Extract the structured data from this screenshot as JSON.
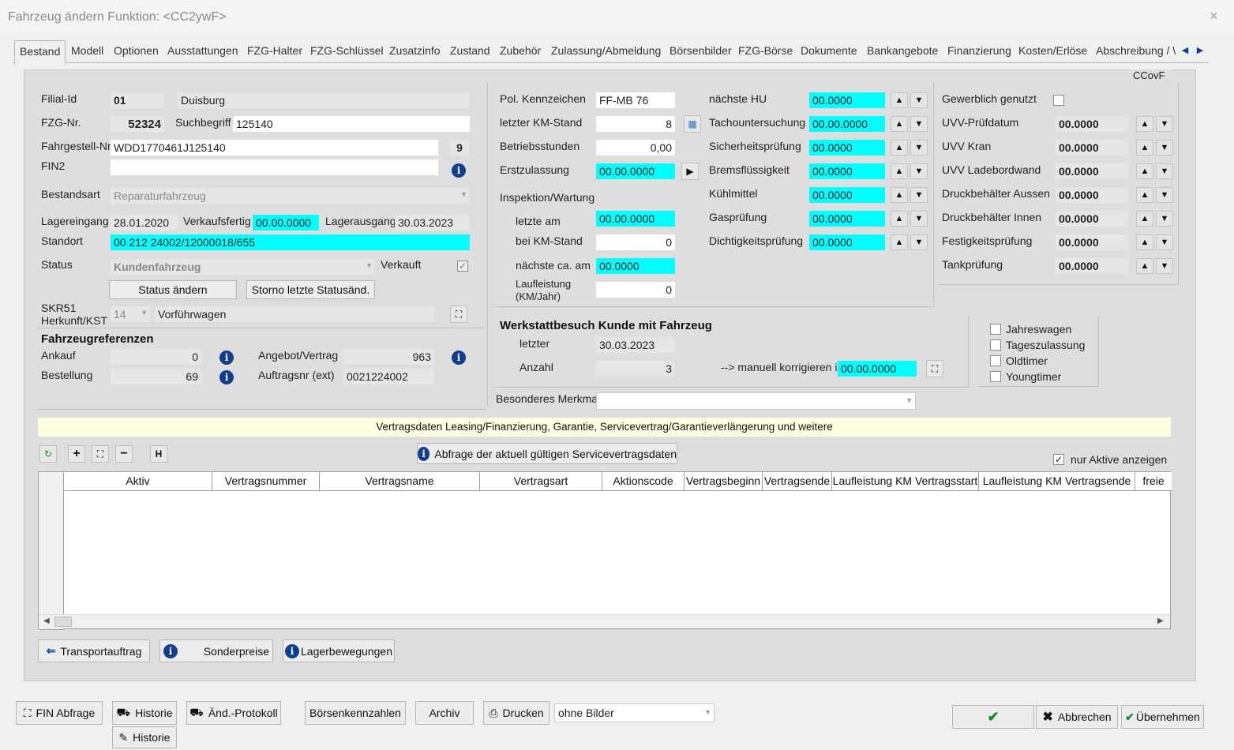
{
  "window": {
    "title": "Fahrzeug ändern   Funktion: <CC2ywF>",
    "close": "×"
  },
  "tabs": [
    "Bestand",
    "Modell",
    "Optionen",
    "Ausstattungen",
    "FZG-Halter",
    "FZG-Schlüssel",
    "Zusatzinfo",
    "Zustand",
    "Zubehör",
    "Zulassung/Abmeldung",
    "Börsenbilder",
    "FZG-Börse",
    "Dokumente",
    "Bankangebote",
    "Finanzierung",
    "Kosten/Erlöse",
    "Abschreibung / \\"
  ],
  "panel_code": "CCovF",
  "left": {
    "filial_label": "Filial-Id",
    "filial_id": "01",
    "filial_name": "Duisburg",
    "fzg_label": "FZG-Nr.",
    "fzg_nr": "52324",
    "such_label": "Suchbegriff",
    "such": "125140",
    "fgst_label": "Fahrgestell-Nr",
    "fgst": "WDD1770461J125140",
    "fgst_check": "9",
    "fin2_label": "FIN2",
    "fin2": "",
    "bestandsart_label": "Bestandsart",
    "bestandsart": "Reparaturfahrzeug",
    "lagereingang_label": "Lagereingang",
    "lagereingang": "28.01.2020",
    "verkaufsfertig_label": "Verkaufsfertig",
    "verkaufsfertig": "00.00.0000",
    "lagerausgang_label": "Lagerausgang",
    "lagerausgang": "30.03.2023",
    "standort_label": "Standort",
    "standort": "00 212 24002/12000018/655",
    "status_label": "Status",
    "status": "Kundenfahrzeug",
    "verkauft_label": "Verkauft",
    "status_aendern": "Status ändern",
    "storno": "Storno letzte Statusänd.",
    "skr_label1": "SKR51",
    "skr_label2": "Herkunft/KST",
    "skr_code": "14",
    "skr_text": "Vorführwagen",
    "ref_title": "Fahrzeugreferenzen",
    "ankauf_label": "Ankauf",
    "ankauf": "0",
    "bestellung_label": "Bestellung",
    "bestellung": "69",
    "angebot_label": "Angebot/Vertrag",
    "angebot": "963",
    "auftrag_label": "Auftragsnr (ext)",
    "auftrag": "0021224002"
  },
  "middle": {
    "kennz_label": "Pol. Kennzeichen",
    "kennz": "FF-MB 76",
    "km_label": "letzter KM-Stand",
    "km": "8",
    "betrieb_label": "Betriebsstunden",
    "betrieb": "0,00",
    "erstzul_label": "Erstzulassung",
    "erstzul": "00.00.0000",
    "insp_label": "Inspektion/Wartung",
    "letzte_label": "letzte am",
    "letzte": "00.00.0000",
    "beikm_label": "bei KM-Stand",
    "beikm": "0",
    "naechste_label": "nächste ca. am",
    "naechste": "00.0000",
    "lauf_label1": "Laufleistung",
    "lauf_label2": "(KM/Jahr)",
    "lauf": "0"
  },
  "checks_mid": [
    {
      "label": "nächste HU",
      "value": "00.0000"
    },
    {
      "label": "Tachountersuchung",
      "value": "00.00.0000"
    },
    {
      "label": "Sicherheitsprüfung",
      "value": "00.0000"
    },
    {
      "label": "Bremsflüssigkeit",
      "value": "00.0000"
    },
    {
      "label": "Kühlmittel",
      "value": "00.0000"
    },
    {
      "label": "Gasprüfung",
      "value": "00.0000"
    },
    {
      "label": "Dichtigkeitsprüfung",
      "value": "00.0000"
    }
  ],
  "right": {
    "gewerblich_label": "Gewerblich genutzt",
    "items": [
      {
        "label": "UVV-Prüfdatum",
        "value": "00.0000"
      },
      {
        "label": "UVV Kran",
        "value": "00.0000"
      },
      {
        "label": "UVV Ladebordwand",
        "value": "00.0000"
      },
      {
        "label": "Druckbehälter Aussen",
        "value": "00.0000"
      },
      {
        "label": "Druckbehälter Innen",
        "value": "00.0000"
      },
      {
        "label": "Festigkeitsprüfung",
        "value": "00.0000"
      },
      {
        "label": "Tankprüfung",
        "value": "00.0000"
      }
    ]
  },
  "werkstatt": {
    "title": "Werkstattbesuch Kunde mit Fahrzeug",
    "letzter_label": "letzter",
    "letzter": "30.03.2023",
    "anzahl_label": "Anzahl",
    "anzahl": "3",
    "manuell_label": "--> manuell korrigieren in",
    "manuell": "00.00.0000"
  },
  "flags": [
    "Jahreswagen",
    "Tageszulassung",
    "Oldtimer",
    "Youngtimer"
  ],
  "merkmal_label": "Besonderes Merkmal",
  "banner": "Vertragsdaten Leasing/Finanzierung, Garantie, Servicevertrag/Garantieverlängerung und weitere",
  "abfrage_btn": "Abfrage der aktuell gültigen Servicevertragsdaten",
  "nur_aktive": "nur Aktive anzeigen",
  "grid_headers": [
    "Aktiv",
    "Vertragsnummer",
    "Vertragsname",
    "Vertragsart",
    "Aktionscode",
    "Vertragsbeginn",
    "Vertragsende",
    "Laufleistung KM Vertragsstart",
    "Laufleistung KM Vertragsende",
    "freie"
  ],
  "bottom_panel_btns": [
    "Transportauftrag",
    "Sonderpreise",
    "Lagerbewegungen"
  ],
  "footer": {
    "fin": "FIN Abfrage",
    "historie1": "Historie",
    "historie2": "Historie",
    "aend": "Änd.-Protokoll",
    "boersen": "Börsenkennzahlen",
    "archiv": "Archiv",
    "drucken": "Drucken",
    "bilder": "ohne Bilder",
    "abbrechen": "Abbrechen",
    "uebernehmen": "Übernehmen"
  }
}
